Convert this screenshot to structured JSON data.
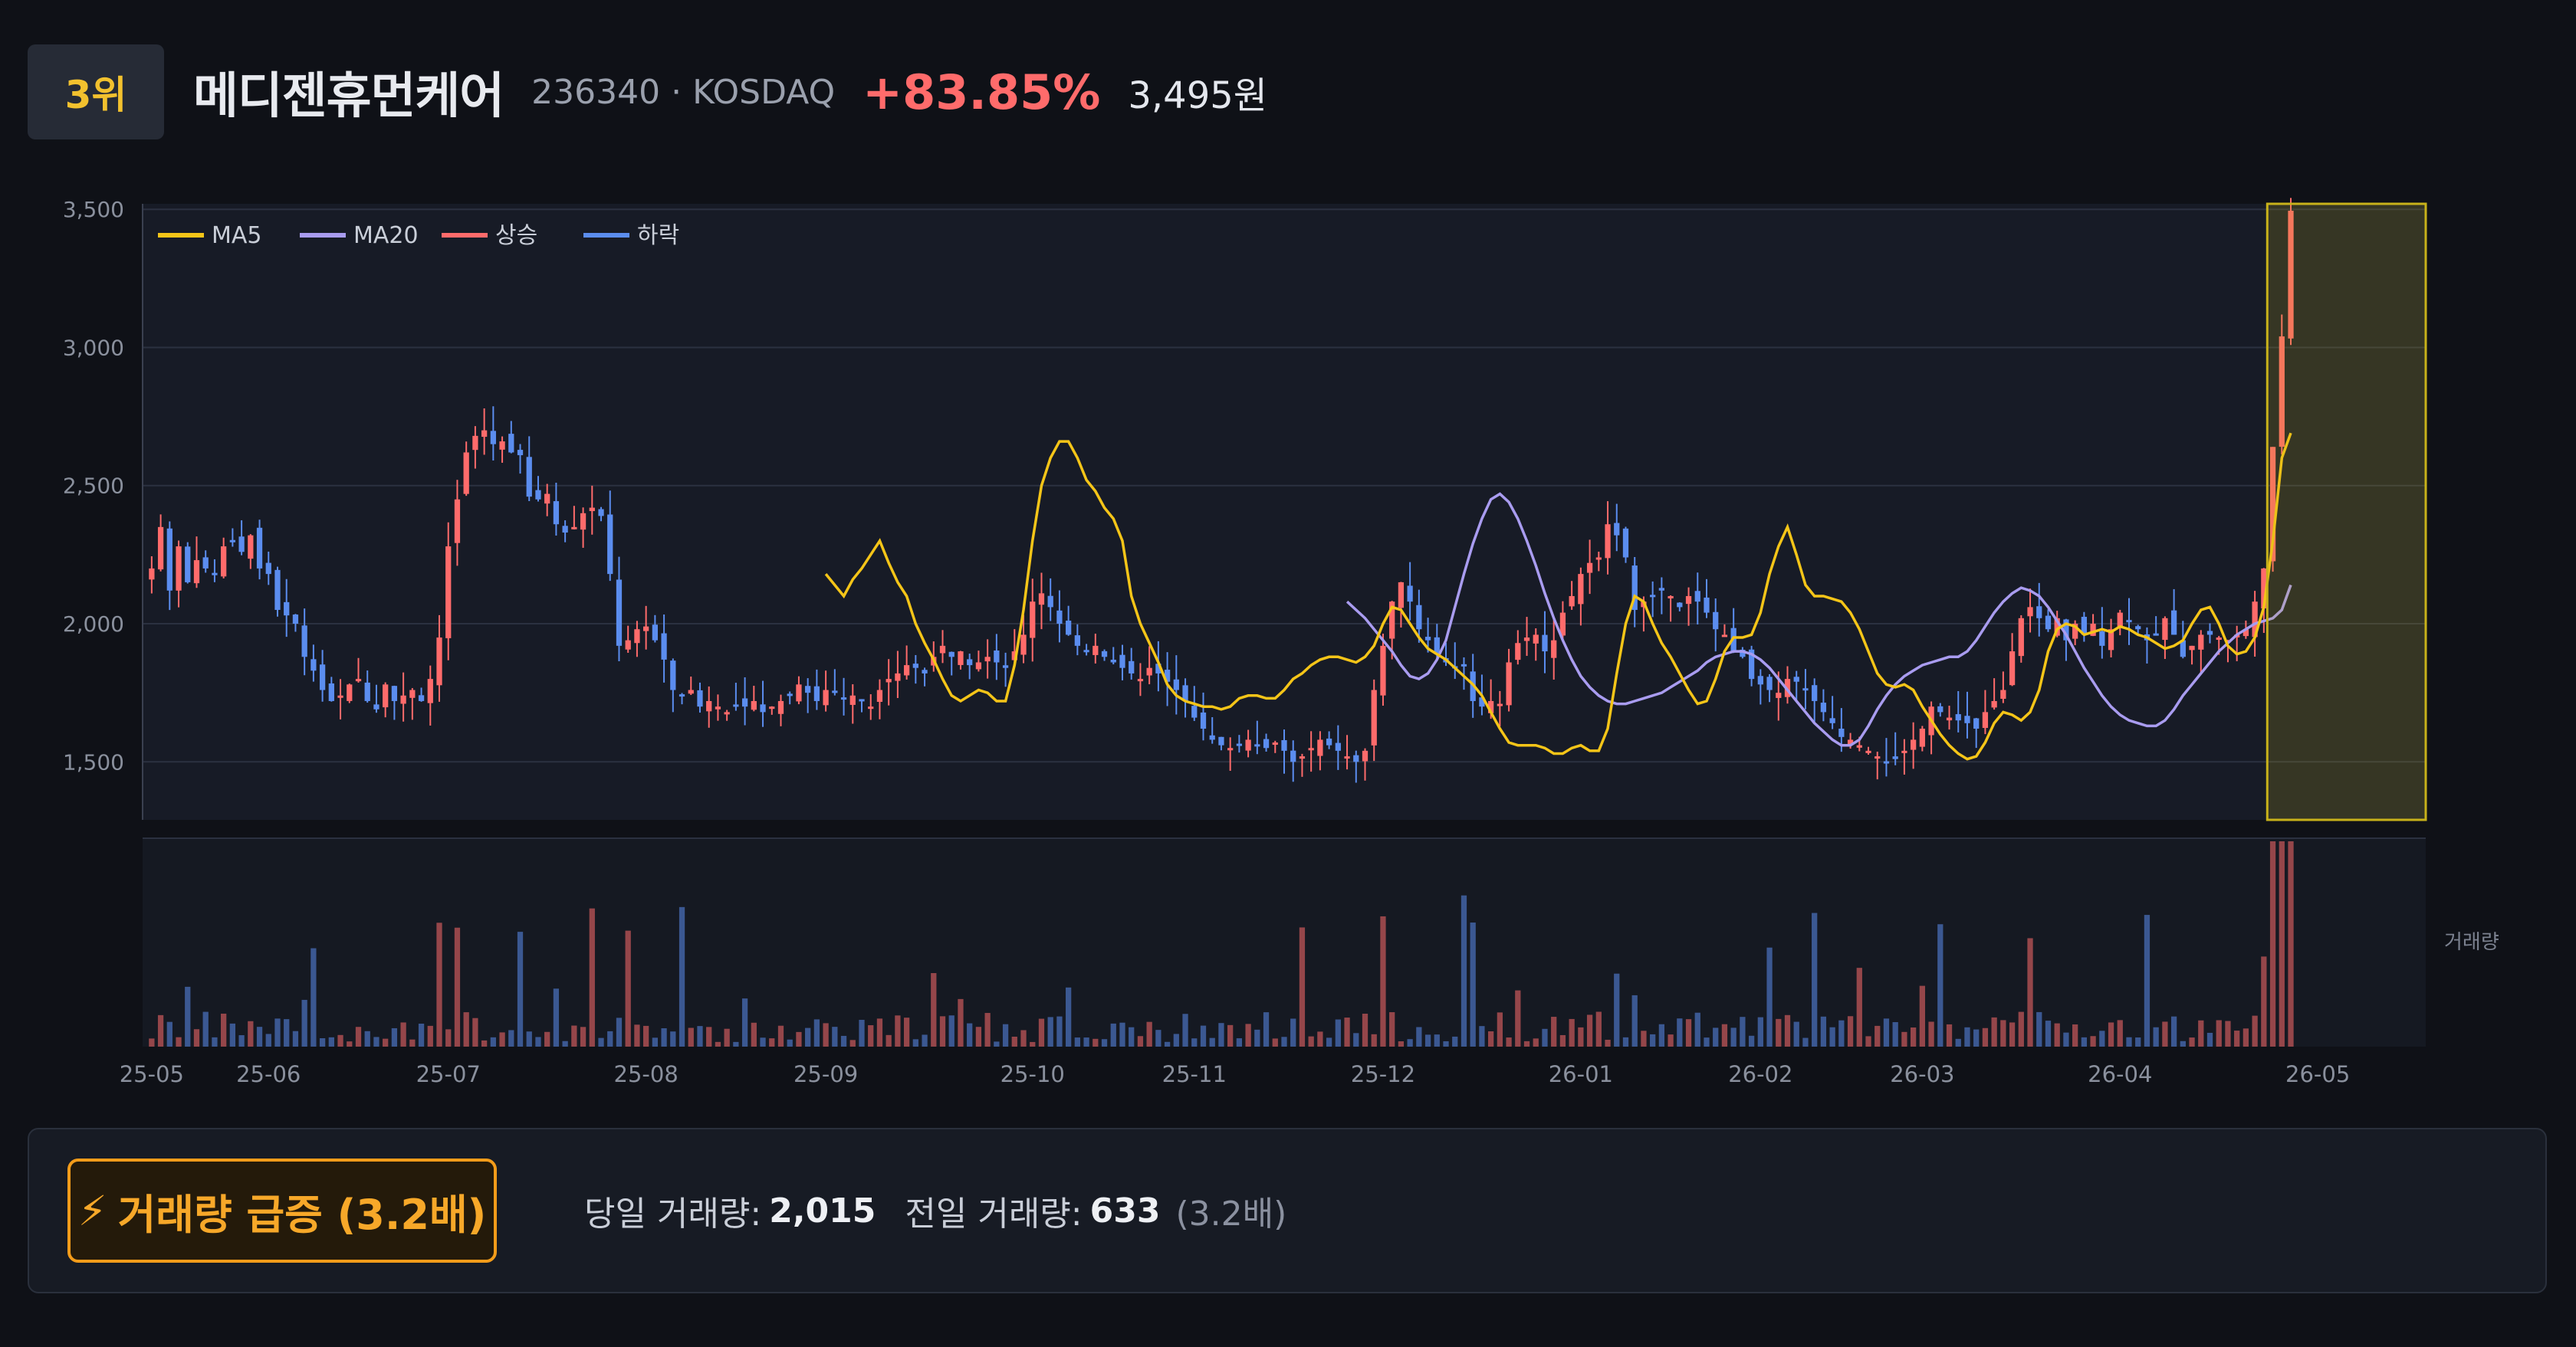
{
  "header": {
    "rank": "3위",
    "name": "메디젠휴먼케어",
    "code": "236340 · KOSDAQ",
    "change": "+83.85%",
    "price": "3,495원"
  },
  "colors": {
    "background": "#0f1117",
    "plot_bg": "#171b26",
    "up": "#ff6b6b",
    "down": "#5b8def",
    "ma5": "#f5c518",
    "ma20": "#a99cf0",
    "highlight": "#c8b21a",
    "surge": "#f39c1a"
  },
  "chart_data": {
    "type": "candlestick",
    "title": "",
    "legend": {
      "position": "top-left",
      "entries": [
        {
          "label": "MA5",
          "color": "#f5c518"
        },
        {
          "label": "MA20",
          "color": "#a99cf0"
        },
        {
          "label": "상승",
          "color": "#ff6b6b"
        },
        {
          "label": "하락",
          "color": "#5b8def"
        }
      ]
    },
    "y_axis": {
      "ticks": [
        1500,
        2000,
        2500,
        3000,
        3500
      ],
      "tick_labels": [
        "1,500",
        "2,000",
        "2,500",
        "3,000",
        "3,500"
      ],
      "range": [
        1290,
        3520
      ]
    },
    "x_axis": {
      "range": [
        0,
        253
      ],
      "tick_positions": [
        0,
        13,
        33,
        55,
        75,
        98,
        116,
        137,
        159,
        179,
        197,
        219,
        241
      ],
      "tick_labels": [
        "25-05",
        "25-06",
        "25-07",
        "25-08",
        "25-09",
        "25-10",
        "25-11",
        "25-12",
        "26-01",
        "26-02",
        "26-03",
        "26-04",
        "26-05"
      ]
    },
    "close_series": [
      2200,
      2350,
      2120,
      2280,
      2150,
      2230,
      2200,
      2180,
      2280,
      2300,
      2260,
      2320,
      2200,
      2180,
      2050,
      2030,
      2000,
      1880,
      1830,
      1760,
      1720,
      1740,
      1780,
      1800,
      1720,
      1690,
      1780,
      1720,
      1740,
      1760,
      1720,
      1800,
      1950,
      2280,
      2450,
      2620,
      2680,
      2700,
      2650,
      2660,
      2620,
      2610,
      2460,
      2450,
      2470,
      2360,
      2330,
      2350,
      2400,
      2420,
      2390,
      2180,
      1920,
      1940,
      1980,
      1990,
      1940,
      1870,
      1760,
      1740,
      1760,
      1700,
      1720,
      1700,
      1680,
      1700,
      1700,
      1720,
      1680,
      1700,
      1720,
      1740,
      1780,
      1750,
      1720,
      1760,
      1750,
      1730,
      1740,
      1720,
      1700,
      1760,
      1800,
      1820,
      1850,
      1840,
      1820,
      1880,
      1920,
      1880,
      1900,
      1850,
      1860,
      1880,
      1860,
      1840,
      1900,
      1960,
      2080,
      2110,
      2060,
      2000,
      1960,
      1920,
      1900,
      1920,
      1880,
      1860,
      1840,
      1820,
      1800,
      1840,
      1820,
      1790,
      1760,
      1720,
      1660,
      1620,
      1580,
      1560,
      1550,
      1560,
      1580,
      1560,
      1550,
      1570,
      1540,
      1500,
      1520,
      1550,
      1580,
      1560,
      1540,
      1520,
      1500,
      1540,
      1760,
      1920,
      2080,
      2150,
      2080,
      1980,
      1940,
      1890,
      1860,
      1840,
      1850,
      1720,
      1700,
      1720,
      1710,
      1860,
      1930,
      1950,
      1960,
      1900,
      1940,
      2040,
      2100,
      2180,
      2220,
      2240,
      2360,
      2320,
      2240,
      2050,
      2080,
      2100,
      2120,
      2100,
      2060,
      2100,
      2080,
      2040,
      1980,
      1960,
      1900,
      1880,
      1800,
      1780,
      1760,
      1750,
      1800,
      1790,
      1760,
      1720,
      1680,
      1640,
      1590,
      1580,
      1560,
      1540,
      1520,
      1500,
      1510,
      1540,
      1580,
      1620,
      1700,
      1680,
      1660,
      1650,
      1640,
      1620,
      1680,
      1720,
      1760,
      1900,
      2020,
      2060,
      2020,
      1980,
      2020,
      1940,
      2000,
      1960,
      2000,
      1920,
      1980,
      2040,
      2010,
      1980,
      1940,
      1960,
      2020,
      1960,
      1880,
      1920,
      1960,
      1960,
      1950,
      1940,
      1960,
      1980,
      2080,
      2200,
      2640,
      3040,
      3495
    ],
    "ma5": [
      2180,
      2140,
      2100,
      2160,
      2200,
      2250,
      2300,
      2220,
      2150,
      2100,
      2000,
      1930,
      1870,
      1800,
      1740,
      1720,
      1740,
      1760,
      1750,
      1720,
      1720,
      1850,
      2050,
      2300,
      2500,
      2600,
      2660,
      2660,
      2600,
      2520,
      2480,
      2420,
      2380,
      2300,
      2100,
      2000,
      1930,
      1860,
      1780,
      1740,
      1720,
      1710,
      1700,
      1700,
      1690,
      1700,
      1730,
      1740,
      1740,
      1730,
      1730,
      1760,
      1800,
      1820,
      1850,
      1870,
      1880,
      1880,
      1870,
      1860,
      1880,
      1920,
      2000,
      2060,
      2050,
      2000,
      1950,
      1910,
      1890,
      1870,
      1840,
      1810,
      1780,
      1740,
      1680,
      1620,
      1570,
      1560,
      1560,
      1560,
      1550,
      1530,
      1530,
      1550,
      1560,
      1540,
      1540,
      1620,
      1820,
      2000,
      2100,
      2080,
      2000,
      1930,
      1880,
      1820,
      1760,
      1710,
      1720,
      1800,
      1900,
      1950,
      1950,
      1960,
      2040,
      2180,
      2280,
      2350,
      2250,
      2140,
      2100,
      2100,
      2090,
      2080,
      2040,
      1980,
      1900,
      1820,
      1780,
      1770,
      1780,
      1760,
      1700,
      1650,
      1600,
      1560,
      1530,
      1510,
      1520,
      1570,
      1640,
      1680,
      1670,
      1650,
      1680,
      1760,
      1900,
      1980,
      2000,
      1990,
      1960,
      1970,
      1980,
      1970,
      1990,
      1980,
      1960,
      1950,
      1930,
      1910,
      1920,
      1940,
      2000,
      2050,
      2060,
      2000,
      1920,
      1890,
      1900,
      1950,
      2060,
      2300,
      2600,
      2690
    ],
    "ma20": [
      2080,
      2050,
      2020,
      1980,
      1940,
      1900,
      1850,
      1810,
      1800,
      1820,
      1870,
      1940,
      2060,
      2180,
      2290,
      2380,
      2450,
      2470,
      2440,
      2380,
      2300,
      2210,
      2110,
      2020,
      1940,
      1870,
      1810,
      1770,
      1740,
      1720,
      1710,
      1710,
      1720,
      1730,
      1740,
      1750,
      1770,
      1790,
      1810,
      1830,
      1860,
      1880,
      1890,
      1900,
      1900,
      1890,
      1870,
      1840,
      1800,
      1760,
      1720,
      1680,
      1640,
      1610,
      1580,
      1560,
      1560,
      1580,
      1630,
      1690,
      1740,
      1780,
      1810,
      1830,
      1850,
      1860,
      1870,
      1880,
      1880,
      1900,
      1940,
      1990,
      2040,
      2080,
      2110,
      2130,
      2120,
      2100,
      2060,
      2010,
      1960,
      1900,
      1840,
      1790,
      1740,
      1700,
      1670,
      1650,
      1640,
      1630,
      1630,
      1650,
      1690,
      1740,
      1780,
      1820,
      1860,
      1900,
      1930,
      1960,
      1980,
      2000,
      2010,
      2020,
      2050,
      2140
    ],
    "volume": {
      "label": "거래량",
      "today": 2015,
      "previous": 633,
      "ratio": 3.2
    }
  },
  "panel": {
    "badge_icon": "lightning-icon",
    "badge_text": "거래량 급증 (3.2배)",
    "today_label": "당일 거래량:",
    "today_value": "2,015",
    "prev_label": "전일 거래량:",
    "prev_value": "633",
    "ratio_text": "(3.2배)"
  }
}
